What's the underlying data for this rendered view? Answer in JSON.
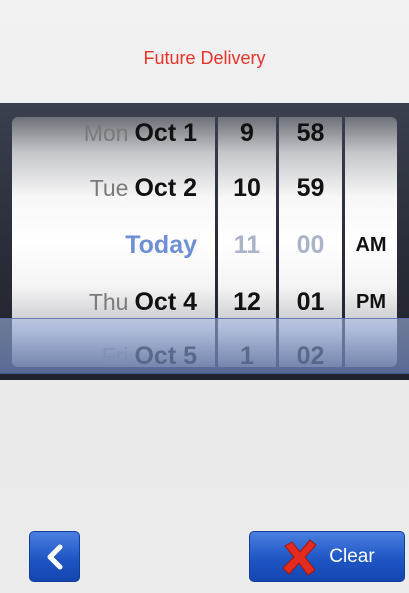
{
  "header": {
    "title": "Future Delivery"
  },
  "picker": {
    "date_wheel": [
      {
        "prefix": "Mon",
        "label": "Oct 1"
      },
      {
        "prefix": "Tue",
        "label": "Oct 2"
      },
      {
        "prefix": "",
        "label": "Today"
      },
      {
        "prefix": "Thu",
        "label": "Oct 4"
      },
      {
        "prefix": "Fri",
        "label": "Oct 5"
      }
    ],
    "hour_wheel": [
      "9",
      "10",
      "11",
      "12",
      "1"
    ],
    "minute_wheel": [
      "58",
      "59",
      "00",
      "01",
      "02"
    ],
    "ampm_wheel": [
      "",
      "",
      "AM",
      "PM",
      ""
    ]
  },
  "footer": {
    "back_icon": "chevron-left-icon",
    "clear_label": "Clear",
    "clear_icon": "red-x-icon"
  },
  "colors": {
    "title": "#e8322a",
    "button_blue": "#1f56c4",
    "selected_text": "#6e8fd6"
  }
}
